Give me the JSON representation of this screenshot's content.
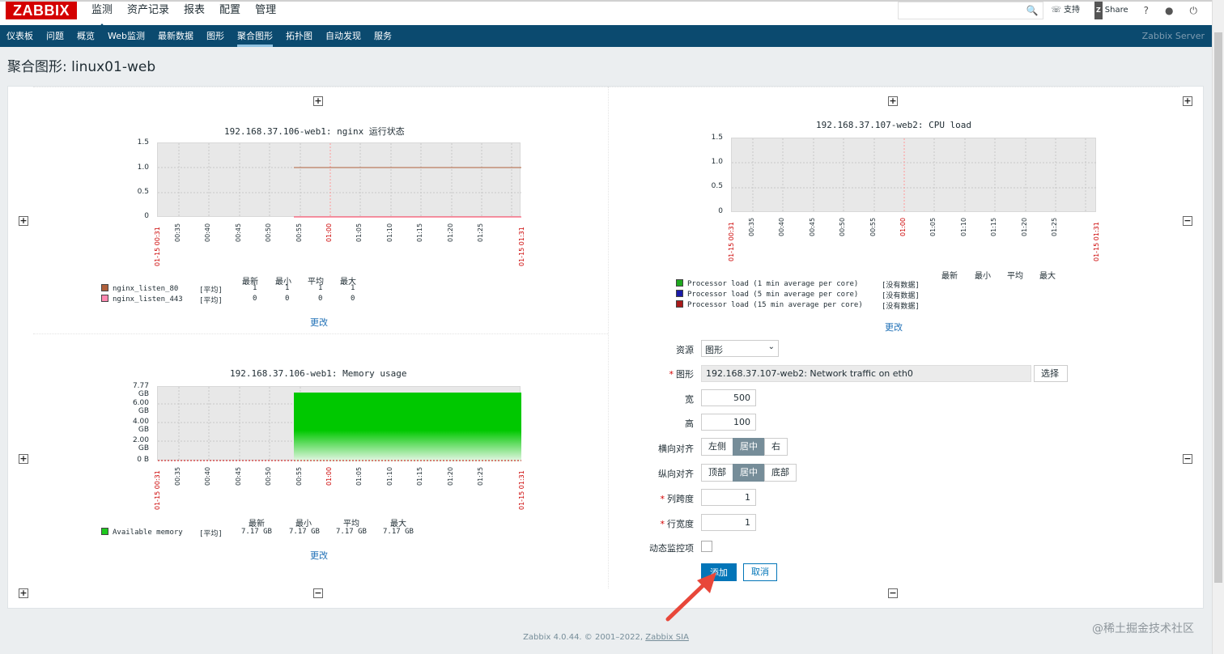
{
  "app": {
    "logo": "ZABBIX"
  },
  "main_nav": [
    "监测",
    "资产记录",
    "报表",
    "配置",
    "管理"
  ],
  "top_right": {
    "support": "支持",
    "share": "Share",
    "help": "?"
  },
  "sub_nav": [
    "仪表板",
    "问题",
    "概览",
    "Web监测",
    "最新数据",
    "图形",
    "聚合图形",
    "拓扑图",
    "自动发现",
    "服务"
  ],
  "server_name": "Zabbix Server",
  "page_title": "聚合图形: linux01-web",
  "graphs": {
    "g1": {
      "title": "192.168.37.106-web1: nginx 运行状态",
      "yticks": [
        "1.5",
        "1.0",
        "0.5",
        "0"
      ],
      "xticks": [
        "00:35",
        "00:40",
        "00:45",
        "00:50",
        "00:55",
        "01:00",
        "01:05",
        "01:10",
        "01:15",
        "01:20",
        "01:25"
      ],
      "x_start": "01-15 00:31",
      "x_end": "01-15 01:31",
      "legend_headers": [
        "最新",
        "最小",
        "平均",
        "最大"
      ],
      "legend": [
        {
          "name": "nginx_listen_80",
          "func": "[平均]",
          "last": "1",
          "min": "1",
          "avg": "1",
          "max": "1",
          "color": "#b0603b"
        },
        {
          "name": "nginx_listen_443",
          "func": "[平均]",
          "last": "0",
          "min": "0",
          "avg": "0",
          "max": "0",
          "color": "#ff88b0"
        }
      ],
      "change_link": "更改"
    },
    "g2": {
      "title": "192.168.37.107-web2: CPU load",
      "yticks": [
        "1.5",
        "1.0",
        "0.5",
        "0"
      ],
      "xticks": [
        "00:35",
        "00:40",
        "00:45",
        "00:50",
        "00:55",
        "01:00",
        "01:05",
        "01:10",
        "01:15",
        "01:20",
        "01:25"
      ],
      "x_start": "01-15 00:31",
      "x_end": "01-15 01:31",
      "legend_headers": [
        "最新",
        "最小",
        "平均",
        "最大"
      ],
      "legend": [
        {
          "name": "Processor load (1 min average per core)",
          "status": "[没有数据]",
          "color": "#1ea81e"
        },
        {
          "name": "Processor load (5 min average per core)",
          "status": "[没有数据]",
          "color": "#1a1aa8"
        },
        {
          "name": "Processor load (15 min average per core)",
          "status": "[没有数据]",
          "color": "#a81a1a"
        }
      ],
      "change_link": "更改"
    },
    "g3": {
      "title": "192.168.37.106-web1: Memory usage",
      "yticks": [
        "7.77 GB",
        "6.00 GB",
        "4.00 GB",
        "2.00 GB",
        "0 B"
      ],
      "xticks": [
        "00:35",
        "00:40",
        "00:45",
        "00:50",
        "00:55",
        "01:00",
        "01:05",
        "01:10",
        "01:15",
        "01:20",
        "01:25"
      ],
      "x_start": "01-15 00:31",
      "x_end": "01-15 01:31",
      "legend_headers": [
        "最新",
        "最小",
        "平均",
        "最大"
      ],
      "legend": [
        {
          "name": "Available memory",
          "func": "[平均]",
          "last": "7.17 GB",
          "min": "7.17 GB",
          "avg": "7.17 GB",
          "max": "7.17 GB",
          "color": "#1ec81e"
        }
      ],
      "change_link": "更改"
    }
  },
  "form": {
    "resource_label": "资源",
    "resource_value": "图形",
    "graph_label": "图形",
    "graph_value": "192.168.37.107-web2: Network traffic on eth0",
    "select_button": "选择",
    "width_label": "宽",
    "width_value": "500",
    "height_label": "高",
    "height_value": "100",
    "halign_label": "横向对齐",
    "halign_options": [
      "左侧",
      "居中",
      "右"
    ],
    "halign_selected": "居中",
    "valign_label": "纵向对齐",
    "valign_options": [
      "顶部",
      "居中",
      "底部"
    ],
    "valign_selected": "居中",
    "colspan_label": "列跨度",
    "colspan_value": "1",
    "rowspan_label": "行宽度",
    "rowspan_value": "1",
    "dynamic_label": "动态监控项",
    "add_button": "添加",
    "cancel_button": "取消"
  },
  "footer": {
    "text": "Zabbix 4.0.44. © 2001–2022, ",
    "link": "Zabbix SIA"
  },
  "watermark": "@稀土掘金技术社区"
}
